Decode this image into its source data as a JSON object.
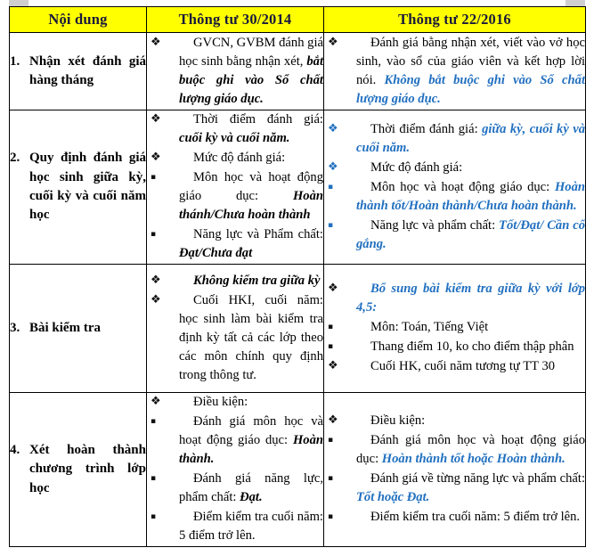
{
  "document": {
    "type": "comparison-table",
    "colors": {
      "header_background": "#ffff00",
      "header_text": "#1a1a3c",
      "emphasis_blue": "#2170c0",
      "border": "#000000",
      "page_background": "#ffffff"
    },
    "icons": {
      "diamond_bullet": "❖",
      "square_bullet": "▪"
    }
  },
  "header": {
    "col1": "Nội dung",
    "col2": "Thông tư 30/2014",
    "col3": "Thông tư 22/2016"
  },
  "rows": [
    {
      "number": "1.",
      "topic": "Nhận xét đánh giá hàng tháng",
      "tt30": [
        {
          "bullet": "diamond",
          "bullet_color": "dark",
          "parts": [
            {
              "text": "GVCN, GVBM đánh giá học sinh bằng nhận xét, ",
              "style": "plain"
            },
            {
              "text": "bắt buộc ghi vào Sổ chất lượng giáo dục.",
              "style": "bold-italic-black"
            }
          ]
        }
      ],
      "tt22": [
        {
          "bullet": "diamond",
          "bullet_color": "dark",
          "parts": [
            {
              "text": "Đánh giá bằng nhận xét, viết vào vở học sinh, vào sổ của giáo viên và kết hợp lời nói. ",
              "style": "plain"
            },
            {
              "text": "Không bắt buộc ghi vào Sổ chất lượng giáo dục.",
              "style": "bold-italic-blue"
            }
          ]
        }
      ]
    },
    {
      "number": "2.",
      "topic": "Quy định đánh giá học sinh giữa kỳ, cuối kỳ và cuối năm học",
      "tt30": [
        {
          "bullet": "diamond",
          "bullet_color": "dark",
          "parts": [
            {
              "text": "Thời điểm đánh giá: ",
              "style": "plain"
            },
            {
              "text": "cuối kỳ và cuối năm.",
              "style": "bold-italic-black"
            }
          ]
        },
        {
          "bullet": "diamond",
          "bullet_color": "dark",
          "parts": [
            {
              "text": "Mức độ đánh giá:",
              "style": "plain"
            }
          ]
        },
        {
          "bullet": "square",
          "bullet_color": "dark",
          "parts": [
            {
              "text": "Môn học và hoạt động giáo dục: ",
              "style": "plain"
            },
            {
              "text": "Hoàn thánh/Chưa hoàn thành",
              "style": "bold-italic-black"
            }
          ]
        },
        {
          "bullet": "square",
          "bullet_color": "dark",
          "parts": [
            {
              "text": "Năng lực và Phẩm chất: ",
              "style": "plain"
            },
            {
              "text": "Đạt/Chưa đạt",
              "style": "bold-italic-black"
            }
          ]
        }
      ],
      "tt22": [
        {
          "bullet": "diamond",
          "bullet_color": "blue",
          "parts": [
            {
              "text": "Thời điểm đánh giá: ",
              "style": "plain"
            },
            {
              "text": "giữa kỳ, cuối kỳ và cuối năm.",
              "style": "bold-italic-blue"
            }
          ]
        },
        {
          "bullet": "diamond",
          "bullet_color": "blue",
          "parts": [
            {
              "text": "Mức độ đánh giá:",
              "style": "plain"
            }
          ]
        },
        {
          "bullet": "square",
          "bullet_color": "blue",
          "parts": [
            {
              "text": "Môn học và hoạt động giáo dục: ",
              "style": "plain"
            },
            {
              "text": "Hoàn thành tốt/Hoàn thành/Chưa hoàn thành.",
              "style": "bold-italic-blue"
            }
          ]
        },
        {
          "bullet": "square",
          "bullet_color": "blue",
          "parts": [
            {
              "text": "Năng lực và phẩm chất: ",
              "style": "plain"
            },
            {
              "text": "Tốt/Đạt/ Cần cố gắng.",
              "style": "bold-italic-blue"
            }
          ]
        }
      ]
    },
    {
      "number": "3.",
      "topic": "Bài kiểm tra",
      "tt30": [
        {
          "bullet": "diamond",
          "bullet_color": "dark",
          "parts": [
            {
              "text": "Không kiểm tra giữa kỳ",
              "style": "bold-italic-black"
            }
          ]
        },
        {
          "bullet": "diamond",
          "bullet_color": "dark",
          "parts": [
            {
              "text": "Cuối HKI, cuối năm: học sinh làm bài kiểm tra định kỳ tất cả các lớp theo các môn chính quy định trong thông tư.",
              "style": "plain"
            }
          ]
        }
      ],
      "tt22": [
        {
          "bullet": "diamond",
          "bullet_color": "dark",
          "parts": [
            {
              "text": "Bổ sung bài kiểm tra giữa kỳ với lớp 4,5:",
              "style": "bold-italic-blue"
            }
          ]
        },
        {
          "bullet": "square",
          "bullet_color": "dark",
          "parts": [
            {
              "text": "Môn: Toán, Tiếng Việt",
              "style": "plain"
            }
          ]
        },
        {
          "bullet": "square",
          "bullet_color": "dark",
          "parts": [
            {
              "text": "Thang điểm 10, ko cho điểm thập phân",
              "style": "plain"
            }
          ]
        },
        {
          "bullet": "diamond",
          "bullet_color": "dark",
          "parts": [
            {
              "text": "Cuối HK, cuối năm tương tự TT 30",
              "style": "plain"
            }
          ]
        }
      ]
    },
    {
      "number": "4.",
      "topic": "Xét hoàn thành chương trình lớp học",
      "tt30": [
        {
          "bullet": "diamond",
          "bullet_color": "dark",
          "parts": [
            {
              "text": "Điều kiện:",
              "style": "plain"
            }
          ]
        },
        {
          "bullet": "square",
          "bullet_color": "dark",
          "parts": [
            {
              "text": "Đánh giá môn học và hoạt động giáo dục: ",
              "style": "plain"
            },
            {
              "text": "Hoàn thành.",
              "style": "bold-italic-black"
            }
          ]
        },
        {
          "bullet": "square",
          "bullet_color": "dark",
          "parts": [
            {
              "text": "Đánh giá năng lực, phẩm chất: ",
              "style": "plain"
            },
            {
              "text": "Đạt.",
              "style": "bold-italic-black"
            }
          ]
        },
        {
          "bullet": "square",
          "bullet_color": "dark",
          "parts": [
            {
              "text": "Điểm kiểm tra cuối năm: 5 điểm trở lên.",
              "style": "plain"
            }
          ]
        }
      ],
      "tt22": [
        {
          "bullet": "diamond",
          "bullet_color": "dark",
          "parts": [
            {
              "text": "Điều kiện:",
              "style": "plain"
            }
          ]
        },
        {
          "bullet": "square",
          "bullet_color": "dark",
          "parts": [
            {
              "text": "Đánh giá môn học và hoạt động giáo dục: ",
              "style": "plain"
            },
            {
              "text": "Hoàn thành tốt hoặc Hoàn thành.",
              "style": "bold-italic-blue"
            }
          ]
        },
        {
          "bullet": "square",
          "bullet_color": "dark",
          "parts": [
            {
              "text": "Đánh giá về từng năng lực và phẩm chất: ",
              "style": "plain"
            },
            {
              "text": "Tốt hoặc Đạt.",
              "style": "bold-italic-blue"
            }
          ]
        },
        {
          "bullet": "square",
          "bullet_color": "dark",
          "parts": [
            {
              "text": "Điểm kiểm tra cuối năm: 5 điểm trở lên.",
              "style": "plain"
            }
          ]
        }
      ]
    }
  ]
}
